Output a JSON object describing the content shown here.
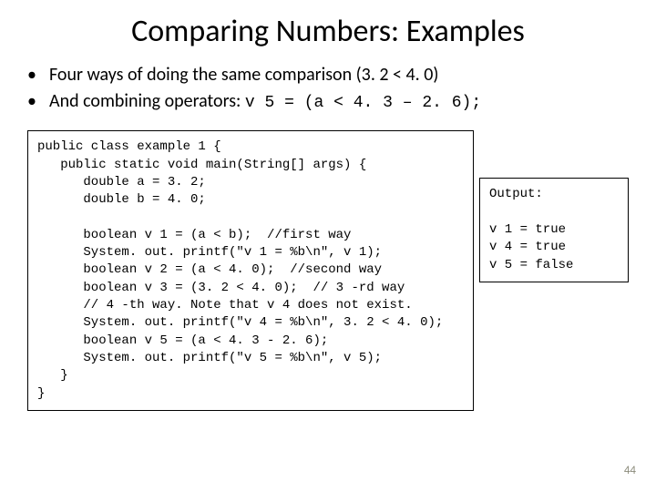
{
  "title": "Comparing Numbers: Examples",
  "bullets": {
    "b1_text": "Four ways of doing the same comparison (3. 2 < 4. 0)",
    "b2_prefix": "And combining operators: ",
    "b2_code": "v 5 = (a < 4. 3 – 2. 6);"
  },
  "code": "public class example 1 {\n   public static void main(String[] args) {\n      double a = 3. 2;\n      double b = 4. 0;\n\n      boolean v 1 = (a < b);  //first way\n      System. out. printf(\"v 1 = %b\\n\", v 1);\n      boolean v 2 = (a < 4. 0);  //second way\n      boolean v 3 = (3. 2 < 4. 0);  // 3 -rd way\n      // 4 -th way. Note that v 4 does not exist.\n      System. out. printf(\"v 4 = %b\\n\", 3. 2 < 4. 0);\n      boolean v 5 = (a < 4. 3 - 2. 6);\n      System. out. printf(\"v 5 = %b\\n\", v 5);\n   }\n}",
  "output": "Output:\n\nv 1 = true\nv 4 = true\nv 5 = false",
  "page_number": "44"
}
